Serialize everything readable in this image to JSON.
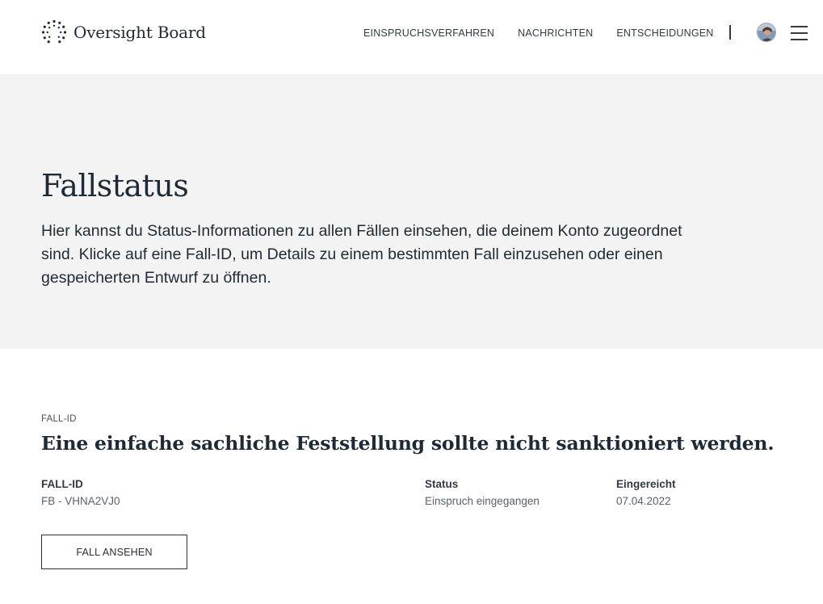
{
  "header": {
    "brand": "Oversight Board",
    "nav": [
      {
        "label": "EINSPRUCHSVERFAHREN"
      },
      {
        "label": "NACHRICHTEN"
      },
      {
        "label": "ENTSCHEIDUNGEN"
      }
    ],
    "icons": {
      "logo": "oversight-board-logo-icon",
      "avatar": "user-avatar",
      "menu": "hamburger-menu-icon"
    }
  },
  "hero": {
    "title": "Fallstatus",
    "description": "Hier kannst du Status-Informationen zu allen Fällen einsehen, die deinem Konto zugeordnet sind. Klicke auf eine Fall-ID, um Details zu einem bestimmten Fall einzusehen oder einen gespeicherten Entwurf zu öffnen."
  },
  "case": {
    "eyebrow": "FALL-ID",
    "title": "Eine einfache sachliche Feststellung sollte nicht sanktioniert werden.",
    "fields": {
      "id_label": "FALL-ID",
      "id_value": "FB - VHNA2VJ0",
      "status_label": "Status",
      "status_value": "Einspruch eingegangen",
      "submitted_label": "Eingereicht",
      "submitted_value": "07.04.2022"
    },
    "button_label": "FALL ANSEHEN"
  },
  "colors": {
    "text_dark": "#1e2a36",
    "hero_bg": "#f3f3f3",
    "muted": "#5a626b"
  }
}
